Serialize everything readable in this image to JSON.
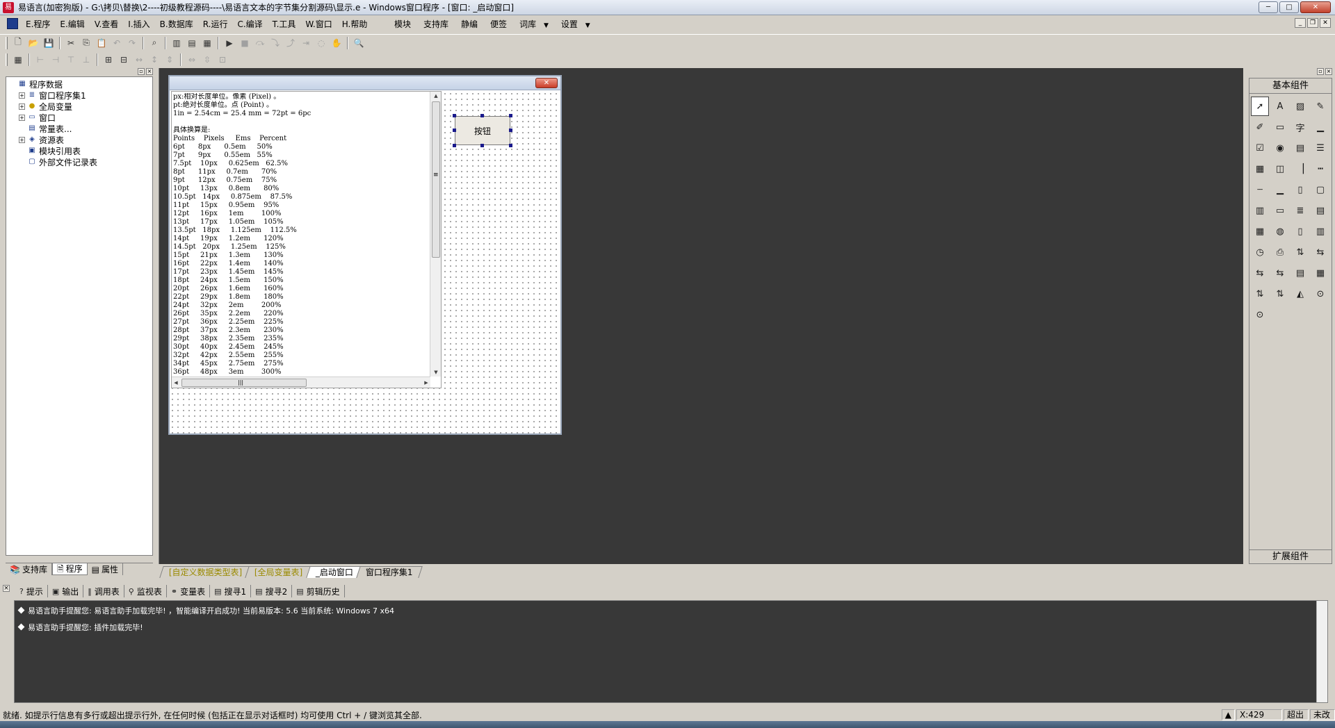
{
  "window": {
    "title": "易语言(加密狗版) - G:\\拷贝\\替换\\2----初级教程源码----\\易语言文本的字节集分割源码\\显示.e - Windows窗口程序 - [窗口: _启动窗口]",
    "min": "─",
    "max": "□",
    "close": "✕"
  },
  "menu": {
    "items": [
      "E.程序",
      "E.编辑",
      "V.查看",
      "I.插入",
      "B.数据库",
      "R.运行",
      "C.编译",
      "T.工具",
      "W.窗口",
      "H.帮助"
    ],
    "right": [
      "模块",
      "支持库",
      "静编",
      "便签",
      "词库",
      "设置"
    ]
  },
  "left_panel": {
    "tree": [
      {
        "label": "程序数据",
        "level": 0,
        "expander": "",
        "icon": "▦"
      },
      {
        "label": "窗口程序集1",
        "level": 1,
        "expander": "+",
        "icon": "≣"
      },
      {
        "label": "全局变量",
        "level": 1,
        "expander": "+",
        "icon": "●"
      },
      {
        "label": "窗口",
        "level": 1,
        "expander": "+",
        "icon": "▭"
      },
      {
        "label": "常量表...",
        "level": 1,
        "expander": "",
        "icon": "▤"
      },
      {
        "label": "资源表",
        "level": 1,
        "expander": "+",
        "icon": "◈"
      },
      {
        "label": "模块引用表",
        "level": 1,
        "expander": "",
        "icon": "▣"
      },
      {
        "label": "外部文件记录表",
        "level": 1,
        "expander": "",
        "icon": "▢"
      }
    ],
    "tabs": [
      "支持库",
      "程序",
      "属性"
    ]
  },
  "designer": {
    "editbox_lines": [
      "px:相对长度单位。像素 (Pixel) 。",
      "pt:绝对长度单位。点 (Point) 。",
      "1in = 2.54cm = 25.4 mm = 72pt = 6pc",
      "",
      "具体换算是:",
      "Points    Pixels     Ems    Percent",
      "6pt      8px      0.5em     50%",
      "7pt      9px      0.55em   55%",
      "7.5pt    10px     0.625em   62.5%",
      "8pt      11px     0.7em      70%",
      "9pt      12px     0.75em    75%",
      "10pt     13px     0.8em      80%",
      "10.5pt   14px     0.875em    87.5%",
      "11pt     15px     0.95em    95%",
      "12pt     16px     1em        100%",
      "13pt     17px     1.05em    105%",
      "13.5pt   18px     1.125em    112.5%",
      "14pt     19px     1.2em      120%",
      "14.5pt   20px     1.25em    125%",
      "15pt     21px     1.3em      130%",
      "16pt     22px     1.4em      140%",
      "17pt     23px     1.45em    145%",
      "18pt     24px     1.5em      150%",
      "20pt     26px     1.6em      160%",
      "22pt     29px     1.8em      180%",
      "24pt     32px     2em        200%",
      "26pt     35px     2.2em      220%",
      "27pt     36px     2.25em    225%",
      "28pt     37px     2.3em      230%",
      "29pt     38px     2.35em    235%",
      "30pt     40px     2.45em    245%",
      "32pt     42px     2.55em    255%",
      "34pt     45px     2.75em    275%",
      "36pt     48px     3em        300%"
    ],
    "button_label": "按钮",
    "hscroll_mark": "|||",
    "vscroll_mark": "≡"
  },
  "workspace_tabs": [
    "[自定义数据类型表]",
    "[全局变量表]",
    "_启动窗口",
    "窗口程序集1"
  ],
  "palette": {
    "title": "基本组件",
    "footer": "扩展组件",
    "icons": [
      "➚",
      "A",
      "▨",
      "✎",
      "✐",
      "▭",
      "字",
      "▁",
      "☑",
      "◉",
      "▤",
      "☰",
      "▦",
      "◫",
      "▕",
      "┅",
      "┄",
      "▁",
      "▯",
      "▢",
      "▥",
      "▭",
      "≣",
      "▤",
      "▦",
      "◍",
      "▯",
      "▥",
      "◷",
      "⎙",
      "⇅",
      "⇆",
      "⇆",
      "⇆",
      "▤",
      "▦",
      "⇅",
      "⇅",
      "◭",
      "⊙",
      "⊙"
    ]
  },
  "output": {
    "tabs": [
      {
        "icon": "?",
        "label": "提示"
      },
      {
        "icon": "▣",
        "label": "输出"
      },
      {
        "icon": "‖",
        "label": "调用表"
      },
      {
        "icon": "⚲",
        "label": "监视表"
      },
      {
        "icon": "⚭",
        "label": "变量表"
      },
      {
        "icon": "▤",
        "label": "搜寻1"
      },
      {
        "icon": "▤",
        "label": "搜寻2"
      },
      {
        "icon": "▤",
        "label": "剪辑历史"
      }
    ],
    "lines": [
      "易语言助手提醒您: 易语言助手加载完毕! ，智能编译开启成功! 当前易版本: 5.6  当前系统: Windows 7 x64",
      "易语言助手提醒您: 插件加载完毕!"
    ]
  },
  "status": {
    "message": "就绪. 如提示行信息有多行或超出提示行外, 在任何时候 (包括正在显示对话框时) 均可使用 Ctrl + / 键浏览其全部.",
    "coord": "X:429",
    "mode": "超出",
    "state": "未改"
  }
}
